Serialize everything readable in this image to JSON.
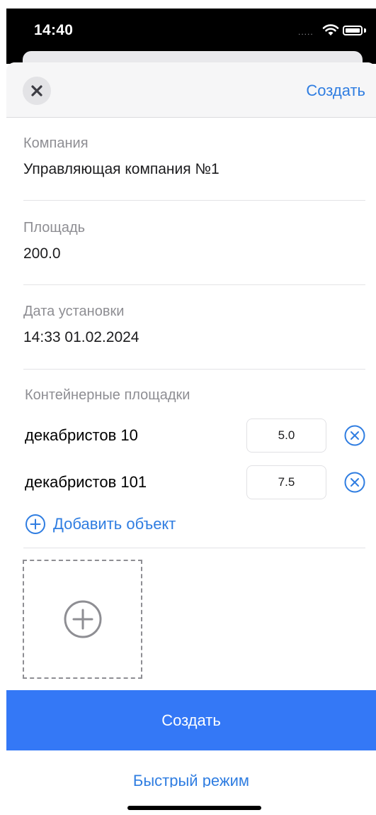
{
  "status_bar": {
    "time": "14:40",
    "signal_dots": "....."
  },
  "nav": {
    "create_label": "Создать"
  },
  "fields": {
    "company": {
      "label": "Компания",
      "value": "Управляющая компания №1"
    },
    "area": {
      "label": "Площадь",
      "value": "200.0"
    },
    "install_date": {
      "label": "Дата установки",
      "value": "14:33 01.02.2024"
    }
  },
  "container_sites": {
    "title": "Контейнерные площадки",
    "items": [
      {
        "name": "декабристов 10",
        "value": "5.0"
      },
      {
        "name": "декабристов 101",
        "value": "7.5"
      }
    ],
    "add_label": "Добавить объект"
  },
  "actions": {
    "create_label": "Создать",
    "quick_mode_label": "Быстрый режим"
  },
  "colors": {
    "accent": "#2f7de1",
    "primary_button": "#3478f6",
    "secondary_text": "#8e8e93"
  },
  "icons": [
    "close-icon",
    "remove-circle-icon",
    "add-circle-icon",
    "add-photo-icon",
    "wifi-icon",
    "battery-icon"
  ]
}
